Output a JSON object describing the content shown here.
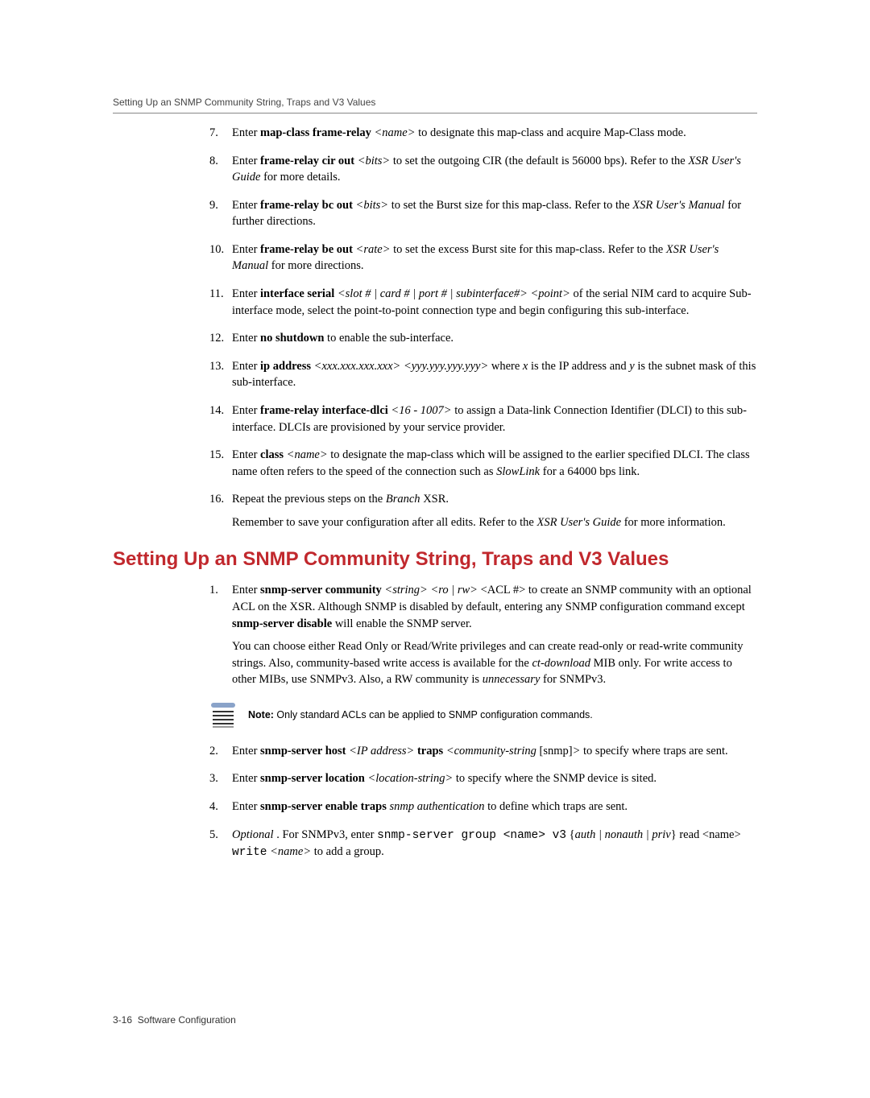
{
  "running_head": "Setting Up an SNMP Community String, Traps and V3 Values",
  "steps_a": {
    "s7": {
      "pre": "Enter ",
      "cmd": "map-class frame-relay",
      "arg": " <name>",
      "post": " to designate this map-class and acquire Map-Class mode."
    },
    "s8": {
      "pre": "Enter ",
      "cmd": "frame-relay cir out",
      "arg": " <bits>",
      "post1": " to set the outgoing CIR (the default is 56000 bps). Refer to the ",
      "ital": "XSR User's Guide",
      "post2": " for more details."
    },
    "s9": {
      "pre": "Enter ",
      "cmd": "frame-relay bc out",
      "arg": " <bits>",
      "post1": " to set the Burst size for this map-class. Refer to the ",
      "ital": "XSR User's Manual",
      "post2": " for further directions."
    },
    "s10": {
      "pre": "Enter ",
      "cmd": "frame-relay be out",
      "arg": " <rate>",
      "post1": " to set the excess Burst site for this map-class. Refer to the ",
      "ital": "XSR User's Manual",
      "post2": " for more directions."
    },
    "s11": {
      "pre": "Enter ",
      "cmd": "interface serial",
      "arg": " <slot # | card # | port # | subinterface#> <point>",
      "post": " of the serial NIM card to acquire Sub-interface mode, select the point-to-point connection type and begin configuring this sub-interface."
    },
    "s12": {
      "pre": "Enter ",
      "cmd": "no shutdown",
      "post": " to enable the sub-interface."
    },
    "s13": {
      "pre": "Enter ",
      "cmd": "ip address",
      "arg": " <xxx.xxx.xxx.xxx> <yyy.yyy.yyy.yyy>",
      "mid1": " where ",
      "x": "x",
      "mid2": " is the IP address and ",
      "y": "y",
      "post": " is the subnet mask of this sub-interface."
    },
    "s14": {
      "pre": "Enter ",
      "cmd": "frame-relay interface-dlci",
      "arg": " <16 - 1007>",
      "post": " to assign a Data-link Connection Identifier (DLCI) to this sub-interface. DLCIs are provisioned by your service provider."
    },
    "s15": {
      "pre": "Enter ",
      "cmd": "class",
      "arg": " <name>",
      "post1": " to designate the map-class which will be assigned to the earlier specified DLCI. The class name often refers to the speed of the connection such as ",
      "ital": "SlowLink",
      "post2": " for a 64000 bps link."
    },
    "s16": {
      "pre": "Repeat the previous steps on the ",
      "ital": "Branch",
      "post": " XSR.",
      "follow1": "Remember to save your configuration after all edits. Refer to the ",
      "follow_ital": "XSR User's Guide",
      "follow2": " for more information."
    }
  },
  "section_title": "Setting Up an SNMP Community String, Traps and V3 Values",
  "steps_b": {
    "s1": {
      "pre": "Enter ",
      "cmd": "snmp-server community",
      "arg": " <string> <ro | rw> ",
      "acl": "<ACL #>",
      "post1": " to create an SNMP community with an optional ACL on the XSR. Although SNMP is disabled by default, entering any SNMP configuration command except ",
      "cmd2": "snmp-server disable",
      "post2": " will enable the SNMP server.",
      "follow1": "You can choose either Read Only or Read/Write privileges and can create read-only or read-write community strings. Also, community-based write access is available for the ",
      "ital1": "ct-download",
      "follow2": " MIB only. For write access to other MIBs, use SNMPv3. Also, a RW community is ",
      "ital2": "unnecessary",
      "follow3": " for SNMPv3."
    }
  },
  "note": {
    "label": "Note:",
    "text": " Only standard ACLs can be applied to SNMP configuration commands."
  },
  "steps_c": {
    "s2": {
      "pre": "Enter ",
      "cmd": "snmp-server host",
      "arg1": " <IP address> ",
      "cmd2": "traps",
      "arg2": " <community-string ",
      "br": "[snmp]",
      "arg3": ">",
      "post": " to specify where traps are sent."
    },
    "s3": {
      "pre": "Enter ",
      "cmd": "snmp-server location",
      "arg": " <location-string>",
      "post": " to specify where the SNMP device is sited."
    },
    "s4": {
      "pre": "Enter ",
      "cmd": "snmp-server enable traps",
      "arg": " snmp authentication",
      "post": " to define which traps are sent."
    },
    "s5": {
      "opt": "Optional",
      "pre": " . For SNMPv3, enter ",
      "tt1": "snmp-server group <name> v3",
      "mid": " {",
      "ital": "auth | nonauth | priv",
      "mid2": "} read <name> ",
      "tt2": "write",
      "arg": " <name>",
      "post": " to add a group."
    }
  },
  "footer": {
    "page": "3-16",
    "label": "Software Configuration"
  }
}
